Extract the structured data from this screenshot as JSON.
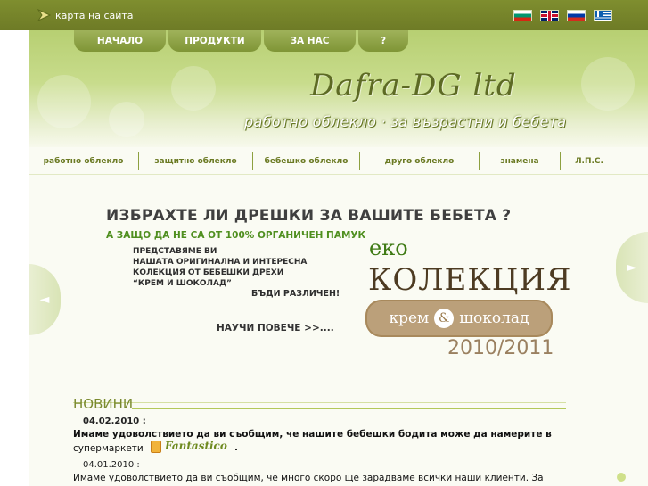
{
  "topbar": {
    "sitemap_label": "карта на сайта",
    "languages": [
      "bulgarian-flag-icon",
      "english-flag-icon",
      "russian-flag-icon",
      "greek-flag-icon"
    ]
  },
  "nav": {
    "items": [
      {
        "label": "НАЧАЛО"
      },
      {
        "label": "ПРОДУКТИ"
      },
      {
        "label": "ЗА НАС"
      },
      {
        "label": "?"
      }
    ]
  },
  "header": {
    "logo_text": "Dafra-DG ltd",
    "tagline": "работно облекло · за възрастни и бебета"
  },
  "categories": [
    {
      "label": "работно облекло"
    },
    {
      "label": "защитно облекло"
    },
    {
      "label": "бебешко облекло"
    },
    {
      "label": "друго облекло"
    },
    {
      "label": "знамена"
    },
    {
      "label": "Л.П.С."
    }
  ],
  "banner": {
    "question": "ИЗБРАХТЕ ЛИ ДРЕШКИ ЗА ВАШИТЕ БЕБЕТА ?",
    "subquestion": "А ЗАЩО ДА НЕ СА ОТ 100% ОРГАНИЧЕН ПАМУК",
    "present_lines": [
      "ПРЕДСТАВЯМЕ ВИ",
      "НАШАТА ОРИГИНАЛНА И ИНТЕРЕСНА",
      "КОЛЕКЦИЯ ОТ БЕБЕШКИ ДРЕХИ",
      "“КРЕМ И ШОКОЛАД”"
    ],
    "be_different": "БЪДИ РАЗЛИЧЕН!",
    "learn_more": "НАУЧИ ПОВЕЧЕ >>....",
    "eko": "еко",
    "collection": "КОЛЕКЦИЯ",
    "cream": "крем",
    "amp": "&",
    "chocolate": "шоколад",
    "years": "2010/2011",
    "prev_icon": "◄",
    "next_icon": "►"
  },
  "news": {
    "title": "НОВИНИ",
    "items": [
      {
        "date": "04.02.2010 :",
        "line1": "Имаме удоволствието да ви съобщим, че нашите бебешки бодита може да намерите в",
        "line2": "супермаркети",
        "brand": "Fantastico",
        "suffix": "."
      },
      {
        "date": "04.01.2010 :",
        "line1": "Имаме удоволствието да ви съобщим, че много скоро ще зарадваме всички наши клиенти.  За"
      }
    ]
  }
}
